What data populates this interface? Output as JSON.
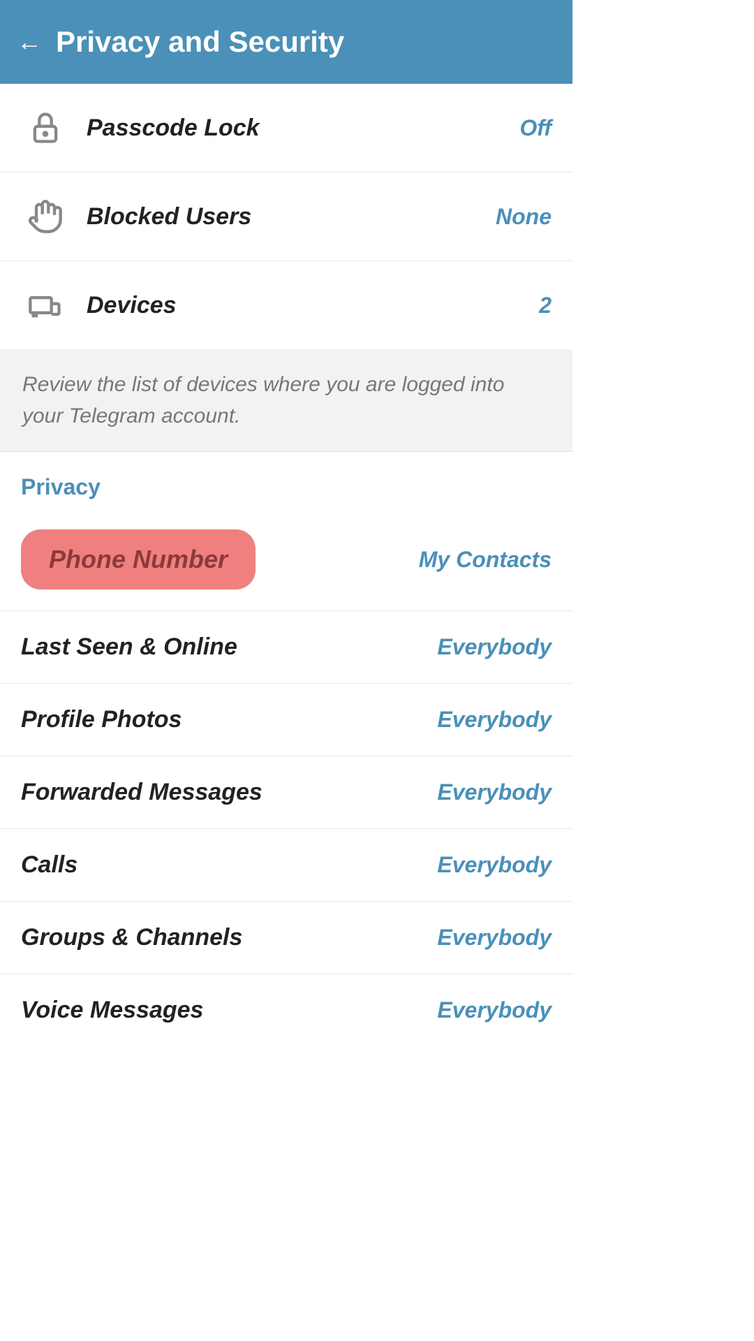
{
  "header": {
    "title": "Privacy and Security",
    "back_icon": "←"
  },
  "colors": {
    "accent": "#4a90b8",
    "header_bg": "#4a90b8",
    "highlight_bg": "#f08080",
    "text_primary": "#222222",
    "text_secondary": "#777777",
    "description_bg": "#f2f2f2",
    "divider": "#e8e8e8"
  },
  "top_items": [
    {
      "id": "passcode-lock",
      "label": "Passcode Lock",
      "value": "Off",
      "icon": "lock"
    },
    {
      "id": "blocked-users",
      "label": "Blocked Users",
      "value": "None",
      "icon": "hand"
    },
    {
      "id": "devices",
      "label": "Devices",
      "value": "2",
      "icon": "devices"
    }
  ],
  "description": "Review the list of devices where you are logged into your Telegram account.",
  "privacy_section": {
    "title": "Privacy",
    "items": [
      {
        "id": "phone-number",
        "label": "Phone Number",
        "value": "My Contacts",
        "highlighted": true
      },
      {
        "id": "last-seen",
        "label": "Last Seen & Online",
        "value": "Everybody",
        "highlighted": false
      },
      {
        "id": "profile-photos",
        "label": "Profile Photos",
        "value": "Everybody",
        "highlighted": false
      },
      {
        "id": "forwarded-messages",
        "label": "Forwarded Messages",
        "value": "Everybody",
        "highlighted": false
      },
      {
        "id": "calls",
        "label": "Calls",
        "value": "Everybody",
        "highlighted": false
      },
      {
        "id": "groups-channels",
        "label": "Groups & Channels",
        "value": "Everybody",
        "highlighted": false
      },
      {
        "id": "voice-messages",
        "label": "Voice Messages",
        "value": "Everybody",
        "highlighted": false,
        "partial": true
      }
    ]
  }
}
